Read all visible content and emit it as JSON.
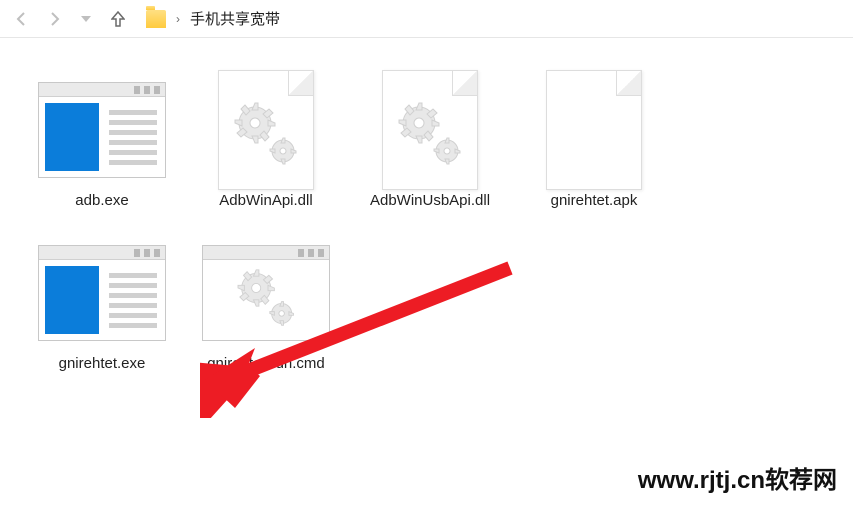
{
  "nav": {
    "breadcrumb": "手机共享宽带"
  },
  "files": [
    {
      "name": "adb.exe",
      "icon": "exe"
    },
    {
      "name": "AdbWinApi.dll",
      "icon": "dll"
    },
    {
      "name": "AdbWinUsbApi.dll",
      "icon": "dll"
    },
    {
      "name": "gnirehtet.apk",
      "icon": "blank"
    },
    {
      "name": "gnirehtet.exe",
      "icon": "exe"
    },
    {
      "name": "gnirehtet-run.cmd",
      "icon": "gearwin"
    }
  ],
  "watermark": "www.rjtj.cn软荐网"
}
